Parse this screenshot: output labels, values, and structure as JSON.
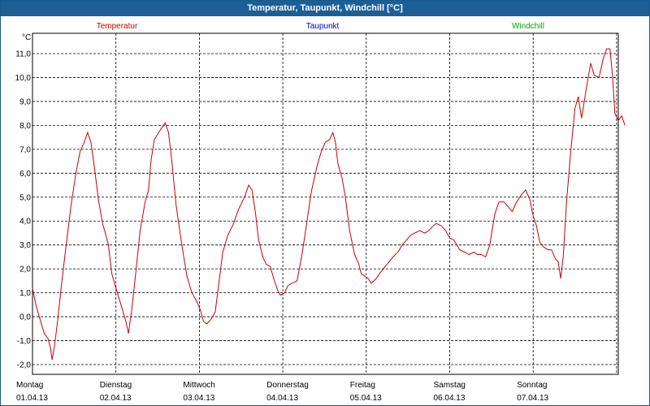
{
  "window_title": "Temperatur, Taupunkt, Windchill [°C]",
  "chart_data": {
    "type": "line",
    "title": "Temperatur, Taupunkt, Windchill [°C]",
    "unit_label": "°C",
    "ylim": [
      -2.5,
      12.0
    ],
    "yticks": [
      -2.0,
      -1.0,
      0.0,
      1.0,
      2.0,
      3.0,
      4.0,
      5.0,
      6.0,
      7.0,
      8.0,
      9.0,
      10.0,
      11.0
    ],
    "ytick_labels": [
      "-2,0",
      "-1,0",
      "0,0",
      "1,0",
      "2,0",
      "3,0",
      "4,0",
      "5,0",
      "6,0",
      "7,0",
      "8,0",
      "9,0",
      "10,0",
      "11,0"
    ],
    "grid": true,
    "legend": [
      {
        "name": "Temperatur",
        "color": "#cc0000"
      },
      {
        "name": "Taupunkt",
        "color": "#0000cc"
      },
      {
        "name": "Windchill",
        "color": "#00aa00"
      }
    ],
    "x_axis": {
      "range_days": [
        0,
        7
      ],
      "day_labels": [
        {
          "weekday": "Montag",
          "date": "01.04.13"
        },
        {
          "weekday": "Dienstag",
          "date": "02.04.13"
        },
        {
          "weekday": "Mittwoch",
          "date": "03.04.13"
        },
        {
          "weekday": "Donnerstag",
          "date": "04.04.13"
        },
        {
          "weekday": "Freitag",
          "date": "05.04.13"
        },
        {
          "weekday": "Samstag",
          "date": "06.04.13"
        },
        {
          "weekday": "Sonntag",
          "date": "07.04.13"
        }
      ]
    },
    "series": [
      {
        "name": "Temperatur",
        "color": "#cc0000",
        "points": [
          [
            0.0,
            1.2
          ],
          [
            0.04,
            0.5
          ],
          [
            0.09,
            -0.1
          ],
          [
            0.14,
            -0.7
          ],
          [
            0.185,
            -0.9
          ],
          [
            0.215,
            -1.3
          ],
          [
            0.235,
            -1.8
          ],
          [
            0.265,
            -1.2
          ],
          [
            0.3,
            -0.2
          ],
          [
            0.35,
            1.4
          ],
          [
            0.4,
            2.9
          ],
          [
            0.46,
            4.6
          ],
          [
            0.52,
            6.0
          ],
          [
            0.57,
            6.9
          ],
          [
            0.62,
            7.3
          ],
          [
            0.66,
            7.7
          ],
          [
            0.7,
            7.3
          ],
          [
            0.74,
            6.3
          ],
          [
            0.79,
            4.9
          ],
          [
            0.84,
            3.9
          ],
          [
            0.91,
            3.0
          ],
          [
            0.95,
            1.8
          ],
          [
            1.0,
            1.2
          ],
          [
            1.06,
            0.5
          ],
          [
            1.12,
            -0.2
          ],
          [
            1.15,
            -0.7
          ],
          [
            1.19,
            0.3
          ],
          [
            1.24,
            1.9
          ],
          [
            1.29,
            3.6
          ],
          [
            1.35,
            4.8
          ],
          [
            1.39,
            5.3
          ],
          [
            1.42,
            6.5
          ],
          [
            1.46,
            7.4
          ],
          [
            1.53,
            7.8
          ],
          [
            1.59,
            8.1
          ],
          [
            1.63,
            7.7
          ],
          [
            1.67,
            6.5
          ],
          [
            1.72,
            4.7
          ],
          [
            1.79,
            3.0
          ],
          [
            1.85,
            1.7
          ],
          [
            1.91,
            1.0
          ],
          [
            1.96,
            0.7
          ],
          [
            2.01,
            0.3
          ],
          [
            2.05,
            -0.2
          ],
          [
            2.09,
            -0.3
          ],
          [
            2.14,
            -0.1
          ],
          [
            2.19,
            0.2
          ],
          [
            2.23,
            1.3
          ],
          [
            2.28,
            2.7
          ],
          [
            2.34,
            3.4
          ],
          [
            2.41,
            3.9
          ],
          [
            2.47,
            4.5
          ],
          [
            2.54,
            5.0
          ],
          [
            2.59,
            5.5
          ],
          [
            2.63,
            5.3
          ],
          [
            2.67,
            4.4
          ],
          [
            2.71,
            3.2
          ],
          [
            2.76,
            2.5
          ],
          [
            2.8,
            2.2
          ],
          [
            2.85,
            2.1
          ],
          [
            2.89,
            1.6
          ],
          [
            2.94,
            1.1
          ],
          [
            2.97,
            0.9
          ],
          [
            3.02,
            1.0
          ],
          [
            3.06,
            1.3
          ],
          [
            3.11,
            1.4
          ],
          [
            3.17,
            1.5
          ],
          [
            3.23,
            2.6
          ],
          [
            3.29,
            4.0
          ],
          [
            3.34,
            5.2
          ],
          [
            3.41,
            6.3
          ],
          [
            3.46,
            6.9
          ],
          [
            3.51,
            7.3
          ],
          [
            3.56,
            7.4
          ],
          [
            3.6,
            7.7
          ],
          [
            3.63,
            7.3
          ],
          [
            3.66,
            6.4
          ],
          [
            3.71,
            5.8
          ],
          [
            3.75,
            5.0
          ],
          [
            3.8,
            3.6
          ],
          [
            3.86,
            2.6
          ],
          [
            3.91,
            2.2
          ],
          [
            3.94,
            1.8
          ],
          [
            3.98,
            1.7
          ],
          [
            4.02,
            1.6
          ],
          [
            4.06,
            1.4
          ],
          [
            4.12,
            1.6
          ],
          [
            4.18,
            1.9
          ],
          [
            4.25,
            2.2
          ],
          [
            4.32,
            2.5
          ],
          [
            4.38,
            2.7
          ],
          [
            4.43,
            3.0
          ],
          [
            4.48,
            3.2
          ],
          [
            4.53,
            3.4
          ],
          [
            4.58,
            3.5
          ],
          [
            4.64,
            3.6
          ],
          [
            4.7,
            3.5
          ],
          [
            4.75,
            3.6
          ],
          [
            4.8,
            3.8
          ],
          [
            4.84,
            3.9
          ],
          [
            4.9,
            3.8
          ],
          [
            4.95,
            3.6
          ],
          [
            5.0,
            3.3
          ],
          [
            5.05,
            3.2
          ],
          [
            5.12,
            2.8
          ],
          [
            5.18,
            2.7
          ],
          [
            5.23,
            2.6
          ],
          [
            5.29,
            2.7
          ],
          [
            5.33,
            2.6
          ],
          [
            5.38,
            2.6
          ],
          [
            5.43,
            2.5
          ],
          [
            5.48,
            3.0
          ],
          [
            5.54,
            4.3
          ],
          [
            5.59,
            4.8
          ],
          [
            5.65,
            4.8
          ],
          [
            5.7,
            4.6
          ],
          [
            5.75,
            4.4
          ],
          [
            5.8,
            4.8
          ],
          [
            5.86,
            5.1
          ],
          [
            5.91,
            5.3
          ],
          [
            5.96,
            4.9
          ],
          [
            6.0,
            4.2
          ],
          [
            6.04,
            3.8
          ],
          [
            6.08,
            3.1
          ],
          [
            6.13,
            2.9
          ],
          [
            6.18,
            2.8
          ],
          [
            6.22,
            2.8
          ],
          [
            6.27,
            2.4
          ],
          [
            6.3,
            2.3
          ],
          [
            6.33,
            1.6
          ],
          [
            6.36,
            2.5
          ],
          [
            6.4,
            4.8
          ],
          [
            6.45,
            6.9
          ],
          [
            6.5,
            8.7
          ],
          [
            6.54,
            9.2
          ],
          [
            6.58,
            8.3
          ],
          [
            6.64,
            9.6
          ],
          [
            6.69,
            10.6
          ],
          [
            6.73,
            10.1
          ],
          [
            6.79,
            10.0
          ],
          [
            6.84,
            10.8
          ],
          [
            6.88,
            11.2
          ],
          [
            6.92,
            11.2
          ],
          [
            6.95,
            10.1
          ],
          [
            6.98,
            8.5
          ],
          [
            7.02,
            8.2
          ],
          [
            7.06,
            8.4
          ],
          [
            7.1,
            8.0
          ]
        ]
      }
    ]
  }
}
